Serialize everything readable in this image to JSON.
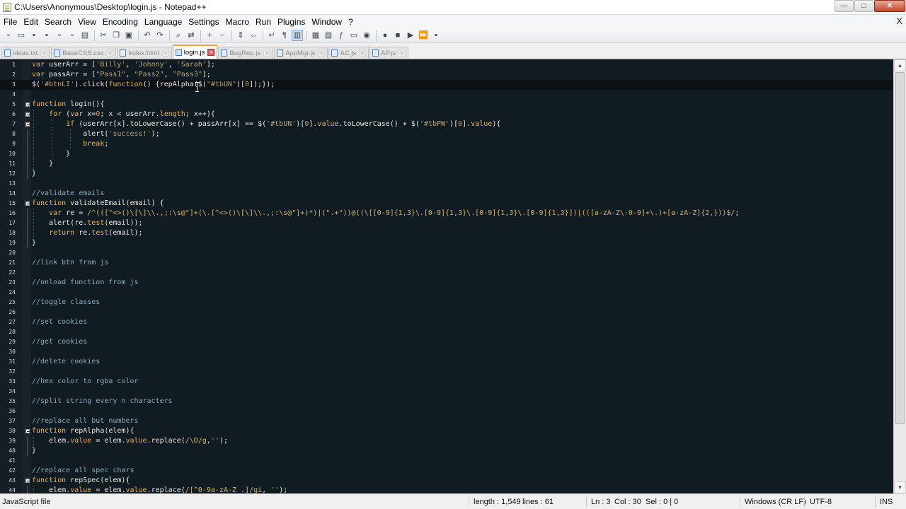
{
  "window": {
    "title": "C:\\Users\\Anonymous\\Desktop\\login.js - Notepad++",
    "controls": [
      "minimize",
      "maximize",
      "close"
    ]
  },
  "menu": {
    "items": [
      "File",
      "Edit",
      "Search",
      "View",
      "Encoding",
      "Language",
      "Settings",
      "Macro",
      "Run",
      "Plugins",
      "Window",
      "?"
    ],
    "close_glyph": "X"
  },
  "toolbar": {
    "buttons": [
      {
        "icon": "new-file-icon",
        "glyph": "▫"
      },
      {
        "icon": "open-file-icon",
        "glyph": "▭"
      },
      {
        "icon": "save-icon",
        "glyph": "▪"
      },
      {
        "icon": "save-all-icon",
        "glyph": "▪"
      },
      {
        "icon": "close-file-icon",
        "glyph": "▫"
      },
      {
        "icon": "close-all-icon",
        "glyph": "▫"
      },
      {
        "icon": "print-icon",
        "glyph": "▤"
      },
      {
        "sep": true
      },
      {
        "icon": "cut-icon",
        "glyph": "✂"
      },
      {
        "icon": "copy-icon",
        "glyph": "❐"
      },
      {
        "icon": "paste-icon",
        "glyph": "▣"
      },
      {
        "sep": true
      },
      {
        "icon": "undo-icon",
        "glyph": "↶"
      },
      {
        "icon": "redo-icon",
        "glyph": "↷"
      },
      {
        "sep": true
      },
      {
        "icon": "find-icon",
        "glyph": "⌕"
      },
      {
        "icon": "replace-icon",
        "glyph": "⇄"
      },
      {
        "sep": true
      },
      {
        "icon": "zoom-in-icon",
        "glyph": "+"
      },
      {
        "icon": "zoom-out-icon",
        "glyph": "−"
      },
      {
        "sep": true
      },
      {
        "icon": "sync-v-scroll-icon",
        "glyph": "⇕"
      },
      {
        "icon": "sync-h-scroll-icon",
        "glyph": "⇔"
      },
      {
        "sep": true
      },
      {
        "icon": "word-wrap-icon",
        "glyph": "↵"
      },
      {
        "icon": "show-all-chars-icon",
        "glyph": "¶"
      },
      {
        "icon": "indent-guide-icon",
        "glyph": "▥",
        "active": true
      },
      {
        "sep": true
      },
      {
        "icon": "user-language-icon",
        "glyph": "▦"
      },
      {
        "icon": "doc-map-icon",
        "glyph": "▧"
      },
      {
        "icon": "function-list-icon",
        "glyph": "ƒ"
      },
      {
        "icon": "folder-workspace-icon",
        "glyph": "▭"
      },
      {
        "icon": "monitoring-icon",
        "glyph": "◉"
      },
      {
        "sep": true
      },
      {
        "icon": "record-macro-icon",
        "glyph": "●"
      },
      {
        "icon": "stop-record-icon",
        "glyph": "■"
      },
      {
        "icon": "play-macro-icon",
        "glyph": "▶"
      },
      {
        "icon": "play-multiple-icon",
        "glyph": "⏩"
      },
      {
        "icon": "save-macro-icon",
        "glyph": "▪"
      }
    ]
  },
  "tabs": [
    {
      "label": "ideas.txt",
      "active": false
    },
    {
      "label": "BaseCSS.css",
      "active": false
    },
    {
      "label": "index.html",
      "active": false
    },
    {
      "label": "login.js",
      "active": true
    },
    {
      "label": "BugRep.js",
      "active": false
    },
    {
      "label": "AppMgr.js",
      "active": false
    },
    {
      "label": "AC.js",
      "active": false
    },
    {
      "label": "AP.js",
      "active": false
    }
  ],
  "editor": {
    "current_line": 3,
    "lines": [
      {
        "n": "1",
        "fold": "",
        "indent": 0,
        "tokens": [
          [
            "kw",
            "var "
          ],
          [
            "fn",
            "userArr = ["
          ],
          [
            "st",
            "'Billy'"
          ],
          [
            "fn",
            ", "
          ],
          [
            "st",
            "'Johnny'"
          ],
          [
            "fn",
            ", "
          ],
          [
            "st",
            "'Sarah'"
          ],
          [
            "fn",
            "];"
          ]
        ]
      },
      {
        "n": "2",
        "fold": "",
        "indent": 0,
        "tokens": [
          [
            "kw",
            "var "
          ],
          [
            "fn",
            "passArr = ["
          ],
          [
            "st",
            "\"Pass1\""
          ],
          [
            "fn",
            ", "
          ],
          [
            "st",
            "\"Pass2\""
          ],
          [
            "fn",
            ", "
          ],
          [
            "st",
            "\"Pass3\""
          ],
          [
            "fn",
            "];"
          ]
        ]
      },
      {
        "n": "3",
        "fold": "",
        "indent": 0,
        "tokens": [
          [
            "fn",
            "$("
          ],
          [
            "st",
            "'#btnLI'"
          ],
          [
            "fn",
            ")."
          ],
          [
            "fn",
            "click("
          ],
          [
            "kw",
            "function"
          ],
          [
            "fn",
            "() {repAlpha($("
          ],
          [
            "st",
            "\"#tbUN\""
          ],
          [
            "fn",
            ")["
          ],
          [
            "nm",
            "0"
          ],
          [
            "fn",
            "]);});"
          ]
        ]
      },
      {
        "n": "4",
        "fold": "",
        "indent": 0,
        "tokens": []
      },
      {
        "n": "5",
        "fold": "box",
        "indent": 0,
        "tokens": [
          [
            "kw",
            "function "
          ],
          [
            "fn",
            "login(){"
          ]
        ]
      },
      {
        "n": "6",
        "fold": "box",
        "indent": 1,
        "tokens": [
          [
            "kw",
            "    for "
          ],
          [
            "fn",
            "("
          ],
          [
            "kw",
            "var "
          ],
          [
            "fn",
            "x="
          ],
          [
            "nm",
            "0"
          ],
          [
            "fn",
            "; x < userArr."
          ],
          [
            "pr",
            "length"
          ],
          [
            "fn",
            "; x++){"
          ]
        ]
      },
      {
        "n": "7",
        "fold": "box",
        "indent": 2,
        "tokens": [
          [
            "kw",
            "        if "
          ],
          [
            "fn",
            "(userArr[x].toLowerCase() + passArr[x] == $("
          ],
          [
            "st",
            "'#tbUN'"
          ],
          [
            "fn",
            ")["
          ],
          [
            "nm",
            "0"
          ],
          [
            "fn",
            "]."
          ],
          [
            "pr",
            "value"
          ],
          [
            "fn",
            ".toLowerCase() + $("
          ],
          [
            "st",
            "'#tbPW'"
          ],
          [
            "fn",
            ")["
          ],
          [
            "nm",
            "0"
          ],
          [
            "fn",
            "]."
          ],
          [
            "pr",
            "value"
          ],
          [
            "fn",
            "){"
          ]
        ]
      },
      {
        "n": "8",
        "fold": "line",
        "indent": 3,
        "tokens": [
          [
            "fn",
            "            alert("
          ],
          [
            "st",
            "'success!'"
          ],
          [
            "fn",
            ");"
          ]
        ]
      },
      {
        "n": "9",
        "fold": "line",
        "indent": 3,
        "tokens": [
          [
            "kw",
            "            break"
          ],
          [
            "fn",
            ";"
          ]
        ]
      },
      {
        "n": "10",
        "fold": "line",
        "indent": 2,
        "tokens": [
          [
            "fn",
            "        }"
          ]
        ]
      },
      {
        "n": "11",
        "fold": "line",
        "indent": 1,
        "tokens": [
          [
            "fn",
            "    }"
          ]
        ]
      },
      {
        "n": "12",
        "fold": "line",
        "indent": 0,
        "tokens": [
          [
            "fn",
            "}"
          ]
        ]
      },
      {
        "n": "13",
        "fold": "",
        "indent": 0,
        "tokens": []
      },
      {
        "n": "14",
        "fold": "",
        "indent": 0,
        "tokens": [
          [
            "cm",
            "//validate emails"
          ]
        ]
      },
      {
        "n": "15",
        "fold": "box",
        "indent": 0,
        "tokens": [
          [
            "kw",
            "function "
          ],
          [
            "fn",
            "validateEmail(email) {"
          ]
        ]
      },
      {
        "n": "16",
        "fold": "line",
        "indent": 1,
        "tokens": [
          [
            "kw",
            "    var "
          ],
          [
            "fn",
            "re = "
          ],
          [
            "rx",
            "/^(([^<>()\\[\\]\\\\.,;:\\s@\"]+(\\.[^<>()\\[\\]\\\\.,;:\\s@\"]+)*)|(\".+\"))@((\\[[0-9]{1,3}\\.[0-9]{1,3}\\.[0-9]{1,3}\\.[0-9]{1,3}])|(([a-zA-Z\\-0-9]+\\.)+[a-zA-Z]{2,}))$/"
          ],
          [
            "fn",
            ";"
          ]
        ]
      },
      {
        "n": "17",
        "fold": "line",
        "indent": 1,
        "tokens": [
          [
            "fn",
            "    alert(re."
          ],
          [
            "pr",
            "test"
          ],
          [
            "fn",
            "(email));"
          ]
        ]
      },
      {
        "n": "18",
        "fold": "line",
        "indent": 1,
        "tokens": [
          [
            "kw",
            "    return "
          ],
          [
            "fn",
            "re."
          ],
          [
            "pr",
            "test"
          ],
          [
            "fn",
            "(email);"
          ]
        ]
      },
      {
        "n": "19",
        "fold": "line",
        "indent": 0,
        "tokens": [
          [
            "fn",
            "}"
          ]
        ]
      },
      {
        "n": "20",
        "fold": "",
        "indent": 0,
        "tokens": []
      },
      {
        "n": "21",
        "fold": "",
        "indent": 0,
        "tokens": [
          [
            "cm",
            "//link btn from js"
          ]
        ]
      },
      {
        "n": "22",
        "fold": "",
        "indent": 0,
        "tokens": []
      },
      {
        "n": "23",
        "fold": "",
        "indent": 0,
        "tokens": [
          [
            "cm",
            "//onload function from js"
          ]
        ]
      },
      {
        "n": "24",
        "fold": "",
        "indent": 0,
        "tokens": []
      },
      {
        "n": "25",
        "fold": "",
        "indent": 0,
        "tokens": [
          [
            "cm",
            "//toggle classes"
          ]
        ]
      },
      {
        "n": "26",
        "fold": "",
        "indent": 0,
        "tokens": []
      },
      {
        "n": "27",
        "fold": "",
        "indent": 0,
        "tokens": [
          [
            "cm",
            "//set cookies"
          ]
        ]
      },
      {
        "n": "28",
        "fold": "",
        "indent": 0,
        "tokens": []
      },
      {
        "n": "29",
        "fold": "",
        "indent": 0,
        "tokens": [
          [
            "cm",
            "//get cookies"
          ]
        ]
      },
      {
        "n": "30",
        "fold": "",
        "indent": 0,
        "tokens": []
      },
      {
        "n": "31",
        "fold": "",
        "indent": 0,
        "tokens": [
          [
            "cm",
            "//delete cookies"
          ]
        ]
      },
      {
        "n": "32",
        "fold": "",
        "indent": 0,
        "tokens": []
      },
      {
        "n": "33",
        "fold": "",
        "indent": 0,
        "tokens": [
          [
            "cm",
            "//hex color to rgba color"
          ]
        ]
      },
      {
        "n": "34",
        "fold": "",
        "indent": 0,
        "tokens": []
      },
      {
        "n": "35",
        "fold": "",
        "indent": 0,
        "tokens": [
          [
            "cm",
            "//split string every n characters"
          ]
        ]
      },
      {
        "n": "36",
        "fold": "",
        "indent": 0,
        "tokens": []
      },
      {
        "n": "37",
        "fold": "",
        "indent": 0,
        "tokens": [
          [
            "cm",
            "//replace all but numbers"
          ]
        ]
      },
      {
        "n": "38",
        "fold": "box",
        "indent": 0,
        "tokens": [
          [
            "kw",
            "function "
          ],
          [
            "fn",
            "repAlpha(elem){"
          ]
        ]
      },
      {
        "n": "39",
        "fold": "line",
        "indent": 1,
        "tokens": [
          [
            "fn",
            "    elem."
          ],
          [
            "pr",
            "value"
          ],
          [
            "fn",
            " = elem."
          ],
          [
            "pr",
            "value"
          ],
          [
            "fn",
            ".replace("
          ],
          [
            "rx",
            "/\\D/g"
          ],
          [
            "fn",
            ","
          ],
          [
            "st",
            "''"
          ],
          [
            "fn",
            ");"
          ]
        ]
      },
      {
        "n": "40",
        "fold": "line",
        "indent": 0,
        "tokens": [
          [
            "fn",
            "}"
          ]
        ]
      },
      {
        "n": "41",
        "fold": "",
        "indent": 0,
        "tokens": []
      },
      {
        "n": "42",
        "fold": "",
        "indent": 0,
        "tokens": [
          [
            "cm",
            "//replace all spec chars"
          ]
        ]
      },
      {
        "n": "43",
        "fold": "box",
        "indent": 0,
        "tokens": [
          [
            "kw",
            "function "
          ],
          [
            "fn",
            "repSpec(elem){"
          ]
        ]
      },
      {
        "n": "44",
        "fold": "line",
        "indent": 1,
        "tokens": [
          [
            "fn",
            "    elem."
          ],
          [
            "pr",
            "value"
          ],
          [
            "fn",
            " = elem."
          ],
          [
            "pr",
            "value"
          ],
          [
            "fn",
            ".replace("
          ],
          [
            "rx",
            "/[^0-9a-zA-Z .]/gi"
          ],
          [
            "fn",
            ", "
          ],
          [
            "st",
            "''"
          ],
          [
            "fn",
            ");"
          ]
        ]
      }
    ]
  },
  "status": {
    "language": "JavaScript file",
    "length": "length : 1,549",
    "lines": "lines : 61",
    "ln": "Ln : 3",
    "col": "Col : 30",
    "sel": "Sel : 0 | 0",
    "eol": "Windows (CR LF)",
    "encoding": "UTF-8",
    "mode": "INS"
  },
  "colors": {
    "editor_bg": "#111b22",
    "keyword": "#e6b84d",
    "string": "#b8a478",
    "comment": "#8fa9b8",
    "active_tab_accent": "#f9a23c"
  }
}
